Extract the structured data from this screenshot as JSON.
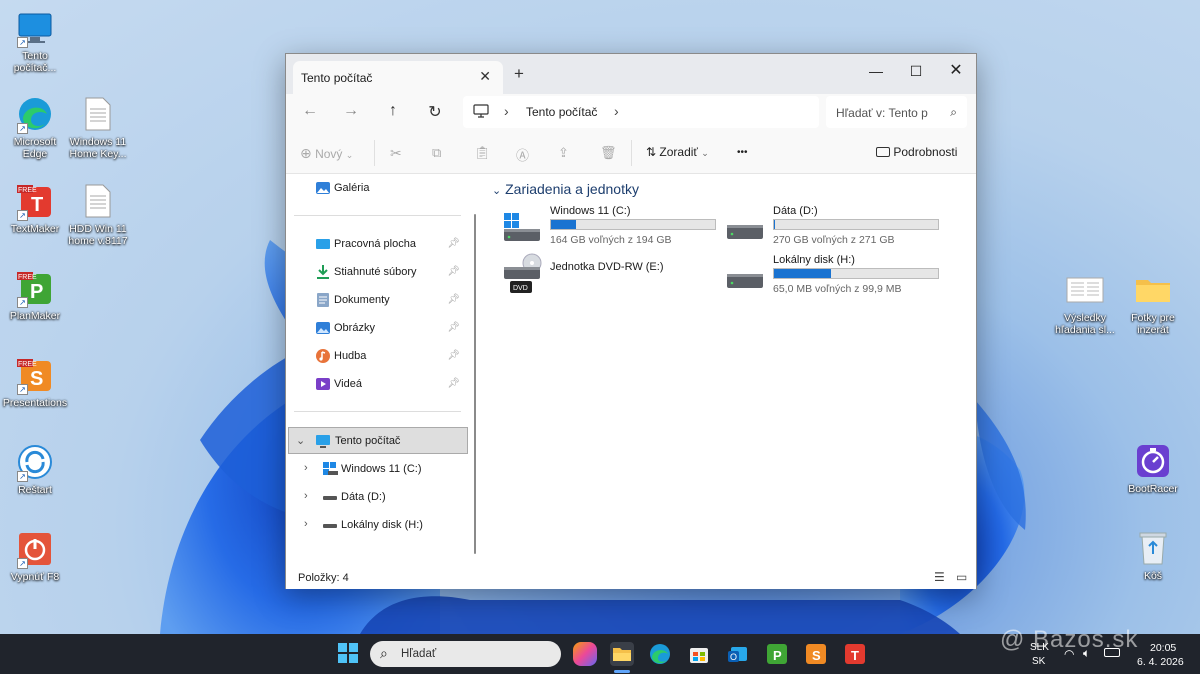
{
  "desktop": {
    "left_icons": [
      {
        "label": "Tento počítač...",
        "icon": "monitor-icon"
      },
      {
        "label": "Microsoft Edge",
        "icon": "edge-icon"
      },
      {
        "label": "Windows 11 Home Key...",
        "icon": "text-file-icon"
      },
      {
        "label": "TextMaker",
        "icon": "textmaker-icon"
      },
      {
        "label": "HDD Win 11 home v.8117",
        "icon": "text-file-icon"
      },
      {
        "label": "PlanMaker",
        "icon": "planmaker-icon"
      },
      {
        "label": "Presentations",
        "icon": "presentations-icon"
      },
      {
        "label": "Reštart",
        "icon": "restart-icon"
      },
      {
        "label": "Vypnúť F8",
        "icon": "power-icon"
      }
    ],
    "right_icons": [
      {
        "label": "Výsledky hľadania sl...",
        "icon": "search-results-icon"
      },
      {
        "label": "Fotky pre inzerát",
        "icon": "folder-icon"
      },
      {
        "label": "BootRacer",
        "icon": "stopwatch-icon"
      },
      {
        "label": "Kôš",
        "icon": "recycle-bin-icon"
      }
    ]
  },
  "window": {
    "tab_title": "Tento počítač",
    "breadcrumb": "Tento počítač",
    "search_placeholder": "Hľadať v: Tento p",
    "toolbar": {
      "new_label": "Nový",
      "sort_label": "Zoradiť",
      "more_label": "•••",
      "details_label": "Podrobnosti"
    },
    "sidebar": {
      "gallery": "Galéria",
      "quick": [
        {
          "label": "Pracovná plocha",
          "icon": "desktop-icon"
        },
        {
          "label": "Stiahnuté súbory",
          "icon": "download-icon"
        },
        {
          "label": "Dokumenty",
          "icon": "documents-icon"
        },
        {
          "label": "Obrázky",
          "icon": "pictures-icon"
        },
        {
          "label": "Hudba",
          "icon": "music-icon"
        },
        {
          "label": "Videá",
          "icon": "videos-icon"
        }
      ],
      "this_pc": "Tento počítač",
      "drives": [
        {
          "label": "Windows 11 (C:)"
        },
        {
          "label": "Dáta (D:)"
        },
        {
          "label": "Lokálny disk (H:)"
        }
      ]
    },
    "main": {
      "group_title": "Zariadenia a jednotky",
      "drives": [
        {
          "name": "Windows 11 (C:)",
          "free_text": "164 GB voľných z 194 GB",
          "used_fraction": 0.155
        },
        {
          "name": "Dáta (D:)",
          "free_text": "270 GB voľných z 271 GB",
          "used_fraction": 0.004
        },
        {
          "name": "Jednotka DVD-RW (E:)",
          "dvd_label": "DVD"
        },
        {
          "name": "Lokálny disk (H:)",
          "free_text": "65,0 MB voľných z 99,9 MB",
          "used_fraction": 0.35
        }
      ]
    },
    "status": "Položky: 4"
  },
  "taskbar": {
    "search_label": "Hľadať",
    "lang_top": "SLK",
    "lang_bottom": "SK",
    "time": "20:05",
    "date": "6. 4. 2026",
    "watermark": "@ Bazos.sk"
  },
  "colors": {
    "accent": "#1a73d1",
    "taskbar": "#20242c"
  }
}
